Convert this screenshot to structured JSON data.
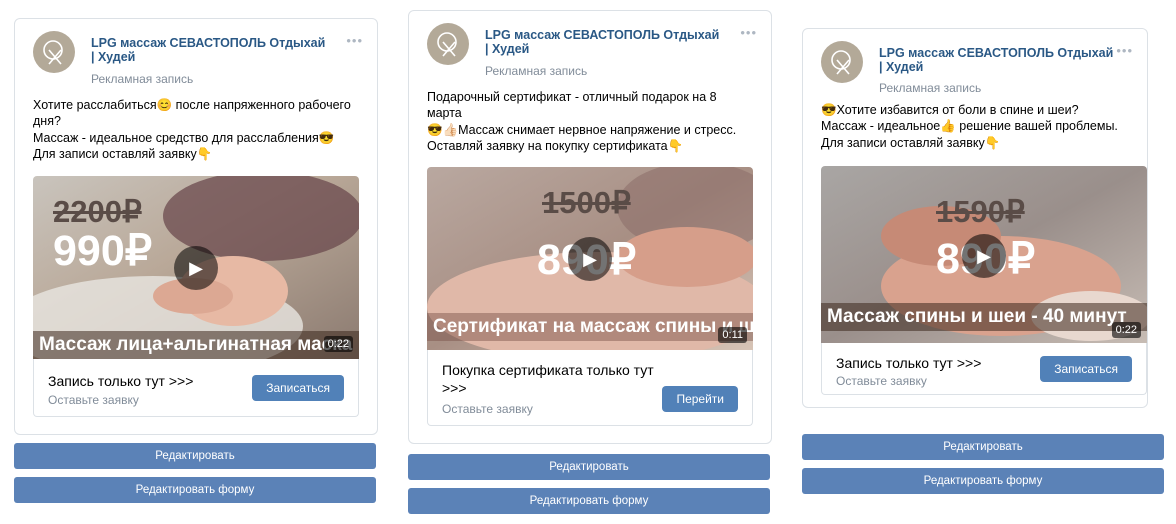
{
  "colors": {
    "accent": "#5181b8",
    "author_link": "#2a5885",
    "muted": "#818c99"
  },
  "icons": {
    "play": "play-icon",
    "more": "more-icon",
    "avatar": "brand-logo-icon"
  },
  "ads": [
    {
      "author": "LPG массаж СЕВАСТОПОЛЬ Отдыхай | Худей",
      "post_type": "Рекламная запись",
      "text_lines": [
        "Хотите расслабиться😊 после напряженного рабочего дня?",
        "Массаж - идеальное средство для расслабления😎",
        "Для записи оставляй заявку👇"
      ],
      "old_price": "2200₽",
      "new_price": "990₽",
      "video_caption": "Массаж лица+альгинатная маска",
      "duration": "0:22",
      "snippet_title": "Запись только тут >>>",
      "snippet_subtitle": "Оставьте заявку",
      "cta": "Записаться",
      "edit_button": "Редактировать",
      "edit_form_button": "Редактировать форму"
    },
    {
      "author": "LPG массаж СЕВАСТОПОЛЬ Отдыхай | Худей",
      "post_type": "Рекламная запись",
      "text_lines": [
        "Подарочный сертификат - отличный подарок на 8 марта",
        "😎👍🏻Массаж снимает нервное напряжение и стресс.",
        "",
        "Оставляй заявку на покупку сертификата👇"
      ],
      "old_price": "1500₽",
      "new_price": "890₽",
      "video_caption": "Сертификат на массаж спины и шеи",
      "duration": "0:11",
      "snippet_title": "Покупка сертификата только тут >>>",
      "snippet_subtitle": "Оставьте заявку",
      "cta": "Перейти",
      "edit_button": "Редактировать",
      "edit_form_button": "Редактировать форму"
    },
    {
      "author": "LPG массаж СЕВАСТОПОЛЬ Отдыхай | Худей",
      "post_type": "Рекламная запись",
      "text_lines": [
        "😎Хотите избавится от боли в спине и шеи?",
        "Массаж - идеальное👍 решение вашей проблемы.",
        "Для записи оставляй заявку👇"
      ],
      "old_price": "1590₽",
      "new_price": "890₽",
      "video_caption": "Массаж спины и шеи - 40 минут",
      "duration": "0:22",
      "snippet_title": "Запись только тут >>>",
      "snippet_subtitle": "Оставьте заявку",
      "cta": "Записаться",
      "edit_button": "Редактировать",
      "edit_form_button": "Редактировать форму"
    }
  ]
}
